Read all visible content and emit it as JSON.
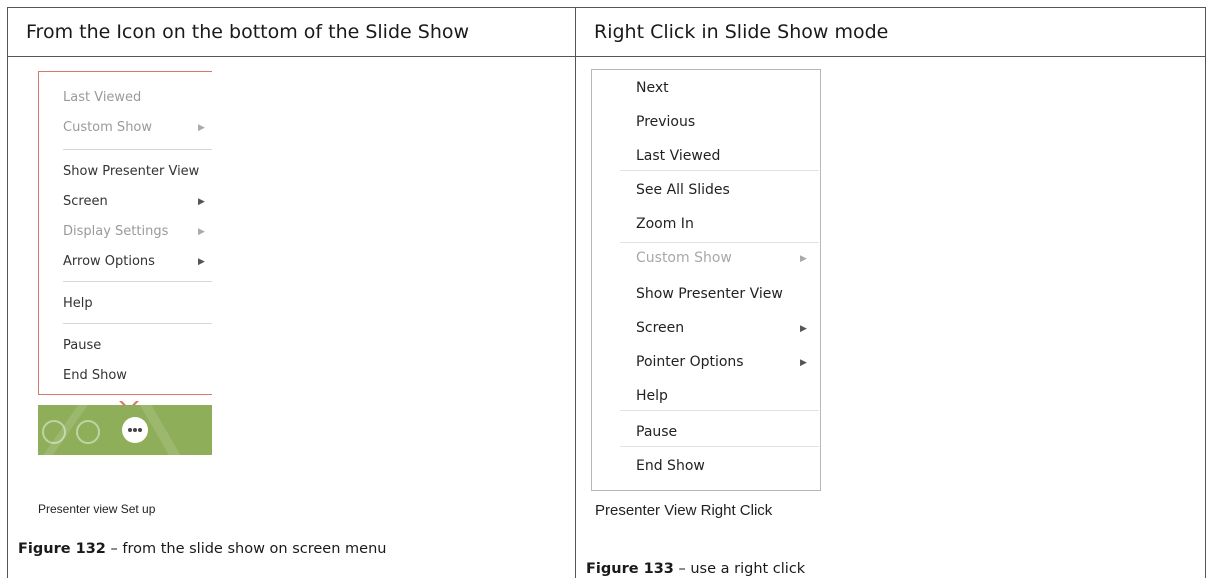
{
  "headers": {
    "left": "From the Icon on the bottom of the Slide Show",
    "right": "Right Click in Slide Show mode"
  },
  "left_menu": {
    "items": [
      {
        "label": "Last Viewed",
        "disabled": true,
        "submenu": false
      },
      {
        "label": "Custom Show",
        "disabled": true,
        "submenu": true
      },
      {
        "label": "Show Presenter View",
        "disabled": false,
        "submenu": false
      },
      {
        "label": "Screen",
        "disabled": false,
        "submenu": true
      },
      {
        "label": "Display Settings",
        "disabled": true,
        "submenu": true
      },
      {
        "label": "Arrow Options",
        "disabled": false,
        "submenu": true
      },
      {
        "label": "Help",
        "disabled": false,
        "submenu": false
      },
      {
        "label": "Pause",
        "disabled": false,
        "submenu": false
      },
      {
        "label": "End Show",
        "disabled": false,
        "submenu": false
      }
    ],
    "caption": "Presenter view Set up"
  },
  "right_menu": {
    "items": [
      {
        "label": "Next",
        "disabled": false,
        "submenu": false
      },
      {
        "label": "Previous",
        "disabled": false,
        "submenu": false
      },
      {
        "label": "Last Viewed",
        "disabled": false,
        "submenu": false
      },
      {
        "label": "See All Slides",
        "disabled": false,
        "submenu": false
      },
      {
        "label": "Zoom In",
        "disabled": false,
        "submenu": false
      },
      {
        "label": "Custom Show",
        "disabled": true,
        "submenu": true
      },
      {
        "label": "Show Presenter View",
        "disabled": false,
        "submenu": false
      },
      {
        "label": "Screen",
        "disabled": false,
        "submenu": true
      },
      {
        "label": "Pointer Options",
        "disabled": false,
        "submenu": true
      },
      {
        "label": "Help",
        "disabled": false,
        "submenu": false
      },
      {
        "label": "Pause",
        "disabled": false,
        "submenu": false
      },
      {
        "label": "End Show",
        "disabled": false,
        "submenu": false
      }
    ],
    "caption": "Presenter View Right Click"
  },
  "figures": {
    "left": {
      "number": "Figure 132",
      "text": " – from the slide show on screen menu"
    },
    "right": {
      "number": "Figure 133",
      "text": " – use a right click"
    }
  },
  "colors": {
    "menu_border_accent": "#d9776a",
    "taskbar_green": "#8fae5a",
    "disabled_text": "#9a9a9a"
  },
  "icons": [
    "submenu-arrow-icon",
    "slides-icon",
    "zoom-icon",
    "more-options-icon"
  ]
}
